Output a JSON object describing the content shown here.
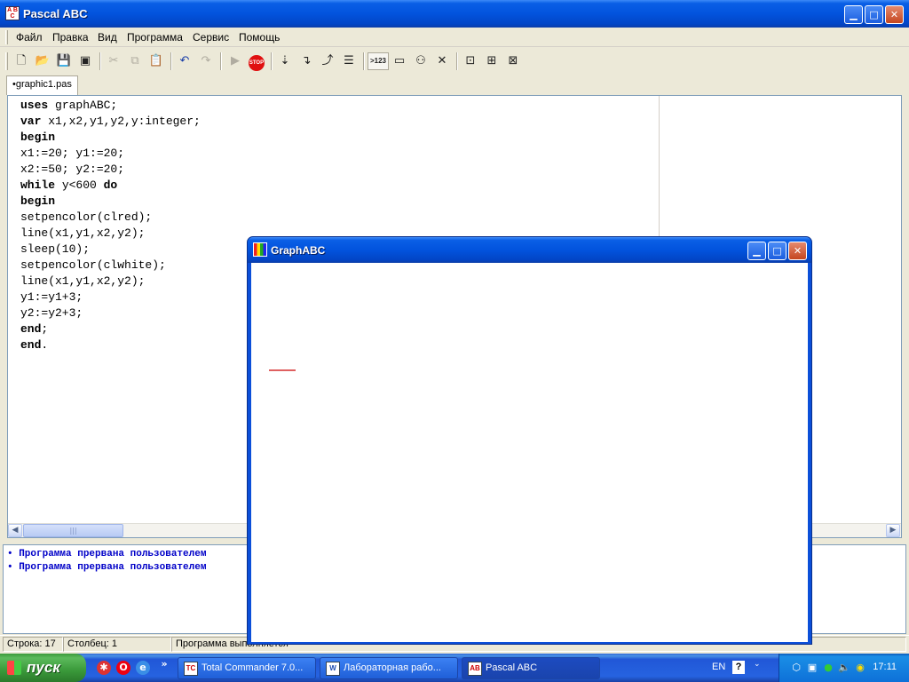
{
  "main_window": {
    "title": "Pascal ABC",
    "icon_text": "A B C"
  },
  "menu": [
    "Файл",
    "Правка",
    "Вид",
    "Программа",
    "Сервис",
    "Помощь"
  ],
  "toolbar": {
    "icons": [
      "new-file-icon",
      "open-file-icon",
      "save-icon",
      "save-all-icon",
      "cut-icon",
      "copy-icon",
      "paste-icon",
      "undo-icon",
      "redo-icon",
      "run-icon",
      "stop-icon",
      "step-into-icon",
      "step-over-icon",
      "step-out-icon",
      "watch-icon",
      "evaluate-icon",
      "output-window-icon",
      "debug-icon",
      "close-icon",
      "format-icon",
      "compile-icon",
      "rebuild-icon"
    ],
    "stop_label": "STOP",
    "eval_label": ">123"
  },
  "tab": {
    "label": "•graphic1.pas"
  },
  "code_lines": [
    {
      "kw": "uses",
      "rest": " graphABC;"
    },
    {
      "kw": "var",
      "rest": " x1,x2,y1,y2,y:integer;"
    },
    {
      "kw": "begin",
      "rest": ""
    },
    {
      "kw": "",
      "rest": "x1:=20; y1:=20;"
    },
    {
      "kw": "",
      "rest": "x2:=50; y2:=20;"
    },
    {
      "kw": "while",
      "rest": " y<600 ",
      "kw2": "do"
    },
    {
      "kw": "begin",
      "rest": ""
    },
    {
      "kw": "",
      "rest": "setpencolor(clred);"
    },
    {
      "kw": "",
      "rest": "line(x1,y1,x2,y2);"
    },
    {
      "kw": "",
      "rest": "sleep(10);"
    },
    {
      "kw": "",
      "rest": "setpencolor(clwhite);"
    },
    {
      "kw": "",
      "rest": "line(x1,y1,x2,y2);"
    },
    {
      "kw": "",
      "rest": "y1:=y1+3;"
    },
    {
      "kw": "",
      "rest": "y2:=y2+3;"
    },
    {
      "kw": "end",
      "rest": ";"
    },
    {
      "kw": "end",
      "rest": "."
    }
  ],
  "output": {
    "lines": [
      "• Программа прервана пользователем",
      "• Программа прервана пользователем"
    ]
  },
  "status": {
    "line": "Строка: 17",
    "column": "Столбец: 1",
    "message": "Программа выполняется"
  },
  "graph_window": {
    "title": "GraphABC",
    "line_color": "#cc0000"
  },
  "taskbar": {
    "start_label": "пуск",
    "tasks": [
      "Total Commander 7.0...",
      "Лабораторная рабо...",
      "Pascal ABC"
    ],
    "language": "EN",
    "clock": "17:11"
  }
}
